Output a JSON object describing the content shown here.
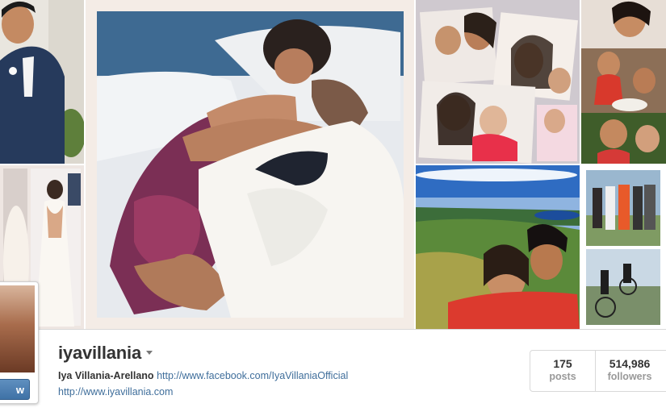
{
  "profile": {
    "username": "iyavillania",
    "full_name": "Iya Villania-Arellano",
    "bio_link": "http://www.facebook.com/IyaVillaniaOfficial",
    "website": "http://www.iyavillania.com",
    "follow_label": "w"
  },
  "stats": {
    "posts": {
      "count": "175",
      "label": "posts"
    },
    "followers": {
      "count": "514,986",
      "label": "followers"
    }
  },
  "colors": {
    "link": "#3f6e9b",
    "follow_button": "#4a7db0"
  }
}
